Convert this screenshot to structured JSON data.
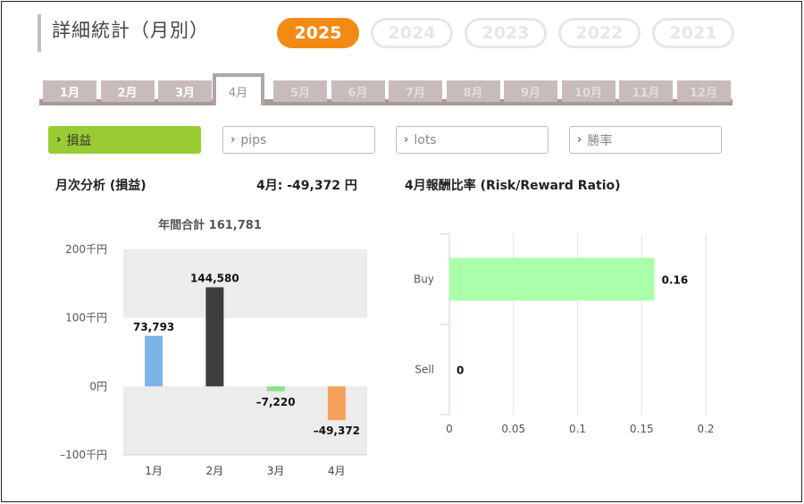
{
  "header": {
    "title": "詳細統計（月別）"
  },
  "years": [
    {
      "label": "2025",
      "active": true
    },
    {
      "label": "2024",
      "active": false
    },
    {
      "label": "2023",
      "active": false
    },
    {
      "label": "2022",
      "active": false
    },
    {
      "label": "2021",
      "active": false
    }
  ],
  "months": [
    {
      "label": "1月",
      "state": "enabled"
    },
    {
      "label": "2月",
      "state": "enabled"
    },
    {
      "label": "3月",
      "state": "enabled"
    },
    {
      "label": "4月",
      "state": "active"
    },
    {
      "label": "5月",
      "state": "disabled"
    },
    {
      "label": "6月",
      "state": "disabled"
    },
    {
      "label": "7月",
      "state": "disabled"
    },
    {
      "label": "8月",
      "state": "disabled"
    },
    {
      "label": "9月",
      "state": "disabled"
    },
    {
      "label": "10月",
      "state": "disabled"
    },
    {
      "label": "11月",
      "state": "disabled"
    },
    {
      "label": "12月",
      "state": "disabled"
    }
  ],
  "filters": [
    {
      "label": "損益",
      "active": true
    },
    {
      "label": "pips",
      "active": false
    },
    {
      "label": "lots",
      "active": false
    },
    {
      "label": "勝率",
      "active": false
    }
  ],
  "left_panel": {
    "heading": "月次分析 (損益)",
    "month_value": "4月:  -49,372 円",
    "chart_title": "年間合計 161,781"
  },
  "right_panel": {
    "heading": "4月報酬比率 (Risk/Reward Ratio)"
  },
  "colors": {
    "accent_orange": "#f38a14",
    "filter_green": "#99cc33",
    "bar_blue": "#7fb3e8",
    "bar_dark": "#3d3d40",
    "bar_green": "#8ee28a",
    "bar_orange": "#f5a05a",
    "hbar_green": "#aaffaa"
  },
  "chart_data": [
    {
      "type": "bar",
      "categories": [
        "1月",
        "2月",
        "3月",
        "4月"
      ],
      "values": [
        73793,
        144580,
        -7220,
        -49372
      ],
      "value_labels": [
        "73,793",
        "144,580",
        "–7,220",
        "–49,372"
      ],
      "y_ticks": [
        "200千円",
        "100千円",
        "0円",
        "–100千円"
      ],
      "ylim": [
        -100000,
        200000
      ],
      "grid": false
    },
    {
      "type": "bar",
      "orientation": "horizontal",
      "categories": [
        "Buy",
        "Sell"
      ],
      "values": [
        0.16,
        0
      ],
      "value_labels": [
        "0.16",
        "0"
      ],
      "x_ticks": [
        "0",
        "0.05",
        "0.1",
        "0.15",
        "0.2"
      ],
      "xlim": [
        0,
        0.2
      ],
      "grid": true
    }
  ]
}
